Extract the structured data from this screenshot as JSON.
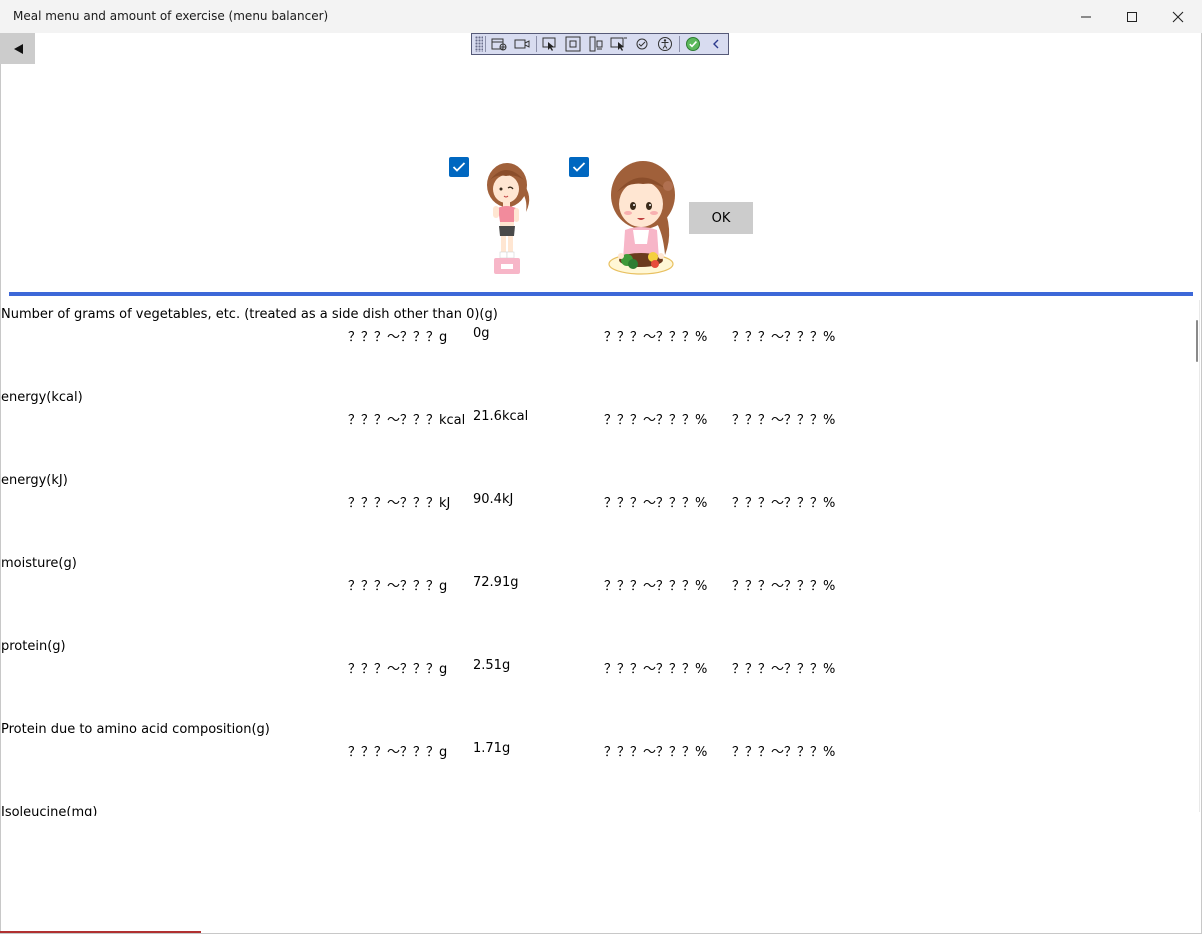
{
  "window": {
    "title": "Meal menu and amount of exercise (menu balancer)",
    "minimize_label": "minimize",
    "maximize_label": "maximize",
    "close_label": "close"
  },
  "toolbar": {
    "icons": [
      "select-element-icon",
      "video-capture-icon",
      "select-pointer-icon",
      "layout-adorner-icon",
      "track-focus-icon",
      "display-layout-icon",
      "hot-reload-icon",
      "accessibility-icon",
      "binding-check-icon",
      "collapse-chevron-icon"
    ]
  },
  "selection": {
    "checkbox_1_checked": true,
    "checkbox_2_checked": true,
    "ok_label": "OK"
  },
  "nutrients": [
    {
      "label": "Number of grams of vegetables, etc. (treated as a side dish other than 0)(g)",
      "range": "？？？～？？？g",
      "value": "0g",
      "pct1": "？？？～？？？%",
      "pct2": "？？？～？？？%"
    },
    {
      "label": "energy(kcal)",
      "range": "？？？～？？？kcal",
      "value": "21.6kcal",
      "pct1": "？？？～？？？%",
      "pct2": "？？？～？？？%"
    },
    {
      "label": "energy(kJ)",
      "range": "？？？～？？？kJ",
      "value": "90.4kJ",
      "pct1": "？？？～？？？%",
      "pct2": "？？？～？？？%"
    },
    {
      "label": "moisture(g)",
      "range": "？？？～？？？g",
      "value": "72.91g",
      "pct1": "？？？～？？？%",
      "pct2": "？？？～？？？%"
    },
    {
      "label": "protein(g)",
      "range": "？？？～？？？g",
      "value": "2.51g",
      "pct1": "？？？～？？？%",
      "pct2": "？？？～？？？%"
    },
    {
      "label": "Protein due to amino acid composition(g)",
      "range": "？？？～？？？g",
      "value": "1.71g",
      "pct1": "？？？～？？？%",
      "pct2": "？？？～？？？%"
    },
    {
      "label": "Isoleucine(mg)",
      "range": "",
      "value": "",
      "pct1": "",
      "pct2": ""
    }
  ],
  "colors": {
    "accent_blue": "#3d68d8",
    "checkbox_blue": "#0067c0",
    "button_gray": "#cccccc"
  }
}
